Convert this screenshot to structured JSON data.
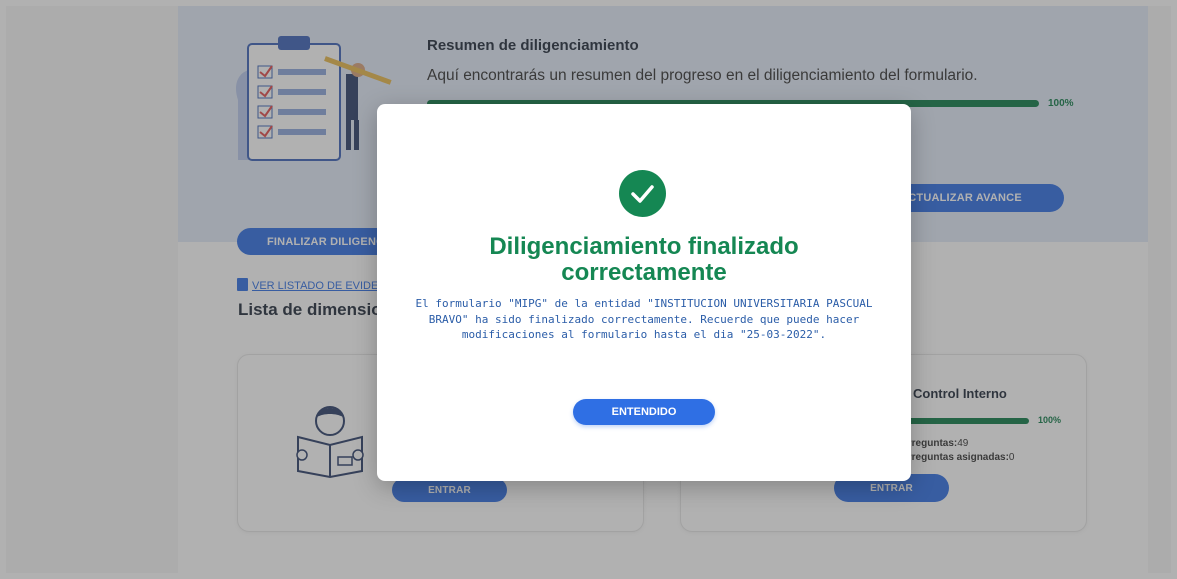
{
  "summary": {
    "title": "Resumen de diligenciamiento",
    "description": "Aquí encontrarás un resumen del progreso en el diligenciamiento del formulario.",
    "progress_percent": 100,
    "progress_label": "100%",
    "update_button": "ACTUALIZAR AVANCE",
    "finalize_button": "FINALIZAR DILIGENCIAMIENTO"
  },
  "dimensions": {
    "view_list_link": "VER LISTADO DE EVIDENCIAS",
    "list_title": "Lista de dimensiones",
    "cards": [
      {
        "title": "",
        "enter_button": "ENTRAR"
      },
      {
        "title": "Control Interno",
        "progress_percent": 100,
        "progress_label": "100%",
        "questions_label": "Preguntas:",
        "questions_value": "49",
        "assigned_label": "Preguntas asignadas:",
        "assigned_value": "0",
        "enter_button": "ENTRAR"
      }
    ]
  },
  "modal": {
    "title": "Diligenciamiento finalizado correctamente",
    "message": "El formulario \"MIPG\" de la entidad \"INSTITUCION UNIVERSITARIA PASCUAL BRAVO\" ha sido finalizado correctamente. Recuerde que puede hacer modificaciones al formulario hasta el dia \"25-03-2022\".",
    "confirm_button": "ENTENDIDO",
    "icon": "check-circle-icon"
  },
  "colors": {
    "primary": "#2f6fe4",
    "success": "#158753",
    "banner": "#e2ebf8",
    "overlay": "rgba(70,70,70,0.42)"
  }
}
